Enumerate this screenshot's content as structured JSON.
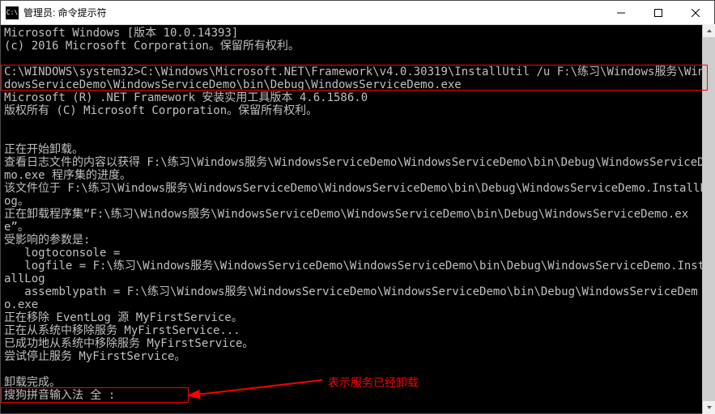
{
  "window": {
    "title": "管理员: 命令提示符",
    "icon_text": "C:\\"
  },
  "terminal": {
    "t0": "Microsoft Windows [版本 10.0.14393]",
    "t1": "(c) 2016 Microsoft Corporation。保留所有权利。",
    "cmd_prompt": "C:\\WINDOWS\\system32>",
    "cmd": "C:\\Windows\\Microsoft.NET\\Framework\\v4.0.30319\\InstallUtil /u F:\\练习\\Windows服务\\WindowsServiceDemo\\WindowsServiceDemo\\bin\\Debug\\WindowsServiceDemo.exe",
    "t2": "Microsoft (R) .NET Framework 安装实用工具版本 4.6.1586.0",
    "t3": "版权所有 (C) Microsoft Corporation。保留所有权利。",
    "t4": "正在开始卸载。",
    "t5": "查看日志文件的内容以获得 F:\\练习\\Windows服务\\WindowsServiceDemo\\WindowsServiceDemo\\bin\\Debug\\WindowsServiceDemo.exe 程序集的进度。",
    "t6": "该文件位于 F:\\练习\\Windows服务\\WindowsServiceDemo\\WindowsServiceDemo\\bin\\Debug\\WindowsServiceDemo.InstallLog。",
    "t7": "正在卸载程序集“F:\\练习\\Windows服务\\WindowsServiceDemo\\WindowsServiceDemo\\bin\\Debug\\WindowsServiceDemo.exe”。",
    "t8": "受影响的参数是:",
    "t9": "   logtoconsole = ",
    "t10": "   logfile = F:\\练习\\Windows服务\\WindowsServiceDemo\\WindowsServiceDemo\\bin\\Debug\\WindowsServiceDemo.InstallLog",
    "t11": "   assemblypath = F:\\练习\\Windows服务\\WindowsServiceDemo\\WindowsServiceDemo\\bin\\Debug\\WindowsServiceDemo.exe",
    "t12": "正在移除 EventLog 源 MyFirstService。",
    "t13": "正在从系统中移除服务 MyFirstService...",
    "t14": "已成功地从系统中移除服务 MyFirstService。",
    "t15": "尝试停止服务 MyFirstService。",
    "t16": "卸载完成。",
    "ime": "搜狗拼音输入法 全 :"
  },
  "annotation": {
    "text": "表示服务已经卸载"
  }
}
